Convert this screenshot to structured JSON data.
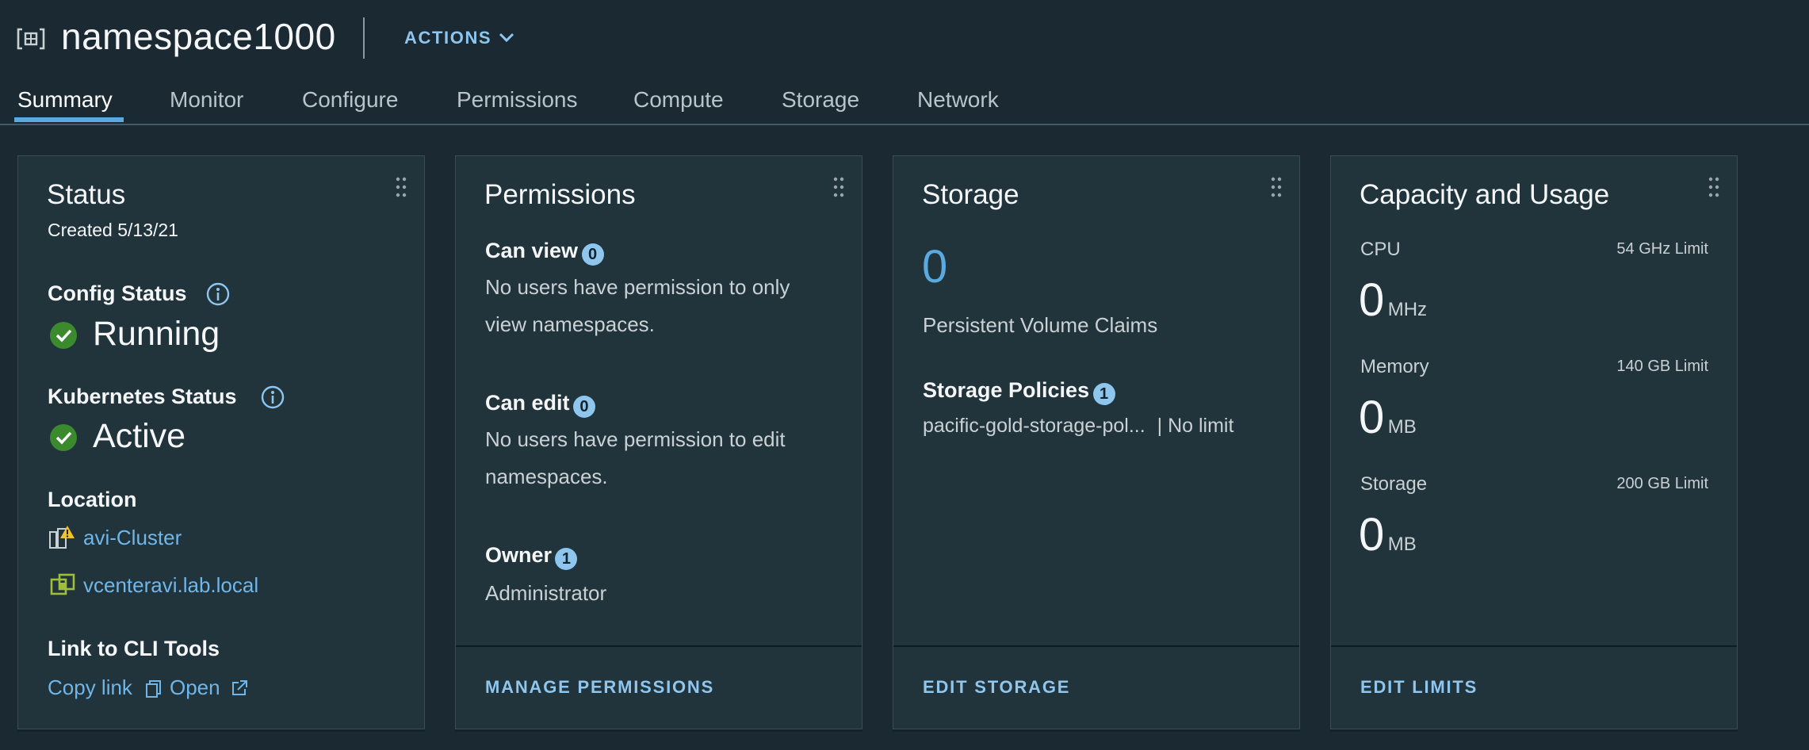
{
  "header": {
    "title": "namespace1000",
    "actions_label": "ACTIONS"
  },
  "tabs": [
    {
      "label": "Summary",
      "active": true
    },
    {
      "label": "Monitor"
    },
    {
      "label": "Configure"
    },
    {
      "label": "Permissions"
    },
    {
      "label": "Compute"
    },
    {
      "label": "Storage"
    },
    {
      "label": "Network"
    }
  ],
  "status_card": {
    "title": "Status",
    "created": "Created 5/13/21",
    "config_status_label": "Config Status",
    "config_status_value": "Running",
    "k8s_status_label": "Kubernetes Status",
    "k8s_status_value": "Active",
    "location_label": "Location",
    "cluster_link": "avi-Cluster",
    "vcenter_link": "vcenteravi.lab.local",
    "cli_label": "Link to CLI Tools",
    "copy_link": "Copy link",
    "open_link": "Open"
  },
  "permissions_card": {
    "title": "Permissions",
    "can_view_label": "Can view",
    "can_view_count": "0",
    "can_view_line1": "No users have permission to only",
    "can_view_line2": "view namespaces.",
    "can_edit_label": "Can edit",
    "can_edit_count": "0",
    "can_edit_line1": "No users have permission to edit",
    "can_edit_line2": "namespaces.",
    "owner_label": "Owner",
    "owner_count": "1",
    "owner_value": "Administrator",
    "footer_button": "MANAGE PERMISSIONS"
  },
  "storage_card": {
    "title": "Storage",
    "pvc_count": "0",
    "pvc_label": "Persistent Volume Claims",
    "policies_label": "Storage Policies",
    "policies_count": "1",
    "policy_name": "pacific-gold-storage-pol...",
    "policy_limit": "| No limit",
    "footer_button": "EDIT STORAGE"
  },
  "capacity_card": {
    "title": "Capacity and Usage",
    "cpu_label": "CPU",
    "cpu_limit": "54 GHz Limit",
    "cpu_value": "0",
    "cpu_unit": "MHz",
    "memory_label": "Memory",
    "memory_limit": "140 GB Limit",
    "memory_value": "0",
    "memory_unit": "MB",
    "storage_label": "Storage",
    "storage_limit": "200 GB Limit",
    "storage_value": "0",
    "storage_unit": "MB",
    "footer_button": "EDIT LIMITS"
  },
  "colors": {
    "background": "#1b2a32",
    "card": "#21333b",
    "accent_link": "#6fb6ea",
    "ok_green": "#3c8a2e",
    "warning_yellow": "#f2c12e"
  },
  "icons": {
    "namespace": "namespace-icon",
    "chevron": "chevron-down-icon",
    "info": "info-icon",
    "ok": "check-circle-icon",
    "cluster": "cluster-warning-icon",
    "vcenter": "vcenter-icon",
    "copy": "copy-icon",
    "external": "external-link-icon",
    "drag": "drag-handle-icon"
  }
}
